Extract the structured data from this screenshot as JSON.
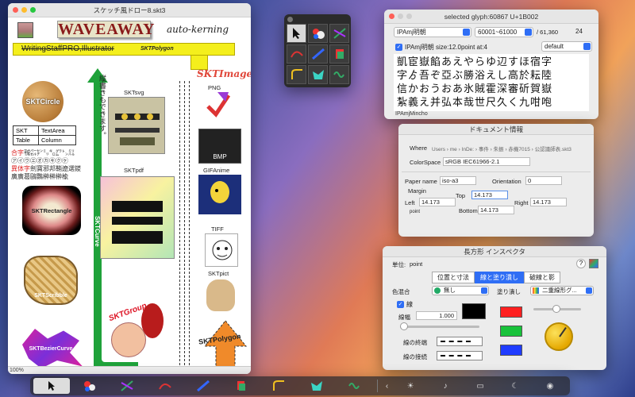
{
  "main_window": {
    "title": "スケッチ風ドロー8.skt3",
    "zoom": "100%",
    "waveaway": "WAVEAWAY",
    "kerning_text": "auto-kerning",
    "writing_staff": "WritingStaffPRO,Illustrator",
    "skt_polygon_small": "SKTPolygon",
    "skt_image": "SKTImage",
    "vertical_text": "縦書きもできます。",
    "skt_circle": "SKTCircle",
    "table": [
      [
        "SKT",
        "TextArea"
      ],
      [
        "Table",
        "Column"
      ]
    ],
    "kanji_line1_red": "合字",
    "kanji_line1": "㍻㌫㌢㍉㌔㌘㌧㍊",
    "kanji_line2": "㋐㋑㋒㋓㋔㋕㋖㋗㋘",
    "kanji_line3_red": "異体字",
    "kanji_line3": "劍寶邪邦鞘遼選鑁",
    "kanji_line4": "廣廣葛鷗鸚榊榊榊楡",
    "skt_rectangle": "SKTRectangle",
    "skt_scribble": "SKTScribble",
    "skt_bezier": "SKTBezierCurve",
    "skt_svg": "SKTsvg",
    "skt_pdf": "SKTpdf",
    "skt_curve": "SKTCurve",
    "png": "PNG",
    "bmp": "BMP",
    "gif": "GIFAnime",
    "tiff": "TIFF",
    "skt_pict": "SKTpict",
    "skt_group": "SKTGroup",
    "skt_polygon": "SKTPolygon"
  },
  "glyph_window": {
    "title": "selected glyph:60867 U+1B002",
    "font": "IPAmj明朝",
    "range": "60001~61000",
    "total": "/ 61,360",
    "size": "24",
    "info": "IPAmj明朝 size:12.0point at:4",
    "mode": "default",
    "glyphs": [
      "凱宦嶽餡あえやらゆ辺すほ宿字",
      "字ゟ吾ぞ亞ぶ勝浴えし高於耘陸",
      "信かおうおあ氷賊霍深審斫賀嶽",
      "紮義え并弘本哉世尺久く九咁咆"
    ],
    "footer": "IPAmjMincho"
  },
  "doc_info": {
    "title": "ドキュメント情報",
    "where_label": "Where",
    "where_value": "Users › me › InDe: › 事件 › 朱振 › 赤機7015 › 公認議師表.skt3",
    "colorspace_label": "ColorSpace",
    "colorspace_value": "sRGB IEC61966-2.1",
    "paper_label": "Paper name",
    "paper_value": "iso-a3",
    "orientation_label": "Orientation",
    "orientation_value": "0",
    "margin_label": "Margin",
    "left_label": "Left",
    "left_value": "14.173",
    "top_label": "Top",
    "top_value": "14.173",
    "right_label": "Right",
    "right_value": "14.173",
    "bottom_label": "Bottom",
    "bottom_value": "14.173",
    "unit": "point"
  },
  "inspector": {
    "title": "長方形 インスペクタ",
    "unit_label": "単位:",
    "unit_value": "point",
    "tabs": [
      "位置と寸法",
      "線と塗り潰し",
      "破線と影"
    ],
    "active_tab": 1,
    "blend_label": "色混合",
    "blend_value": "無し",
    "fill_label": "塗り潰し",
    "fill_value": "二重線形グ...",
    "stroke_label": "線",
    "width_label": "線幅",
    "width_value": "1.000",
    "cap_label": "線の終端",
    "join_label": "線の接続",
    "colors": {
      "stroke": "#000000",
      "red": "#ff2020",
      "green": "#18c23a",
      "blue": "#1f3cff"
    }
  },
  "tools": {
    "items": [
      "arrow-tool",
      "circle-tool",
      "line-tool",
      "curve-tool",
      "pen-tool",
      "image-tool",
      "bezier-tool",
      "polygon-tool",
      "scribble-tool"
    ]
  },
  "dock": {
    "items": [
      "arrow",
      "circles",
      "lines",
      "curve",
      "pen",
      "image",
      "bezier",
      "polygon",
      "scribble"
    ],
    "chevron": "‹",
    "accent": "#2f6ef5"
  }
}
